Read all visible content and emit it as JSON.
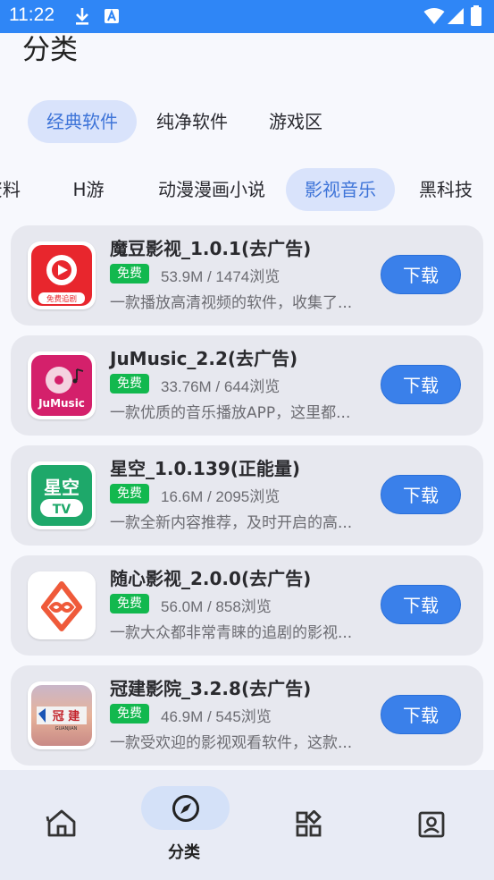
{
  "status_bar": {
    "time": "11:22"
  },
  "page": {
    "title": "分类"
  },
  "primary_tabs": [
    {
      "label": "经典软件",
      "active": true
    },
    {
      "label": "纯净软件",
      "active": false
    },
    {
      "label": "游戏区",
      "active": false
    }
  ],
  "secondary_tabs": [
    {
      "label": "资料",
      "active": false
    },
    {
      "label": "H游",
      "active": false
    },
    {
      "label": "动漫漫画小说",
      "active": false
    },
    {
      "label": "影视音乐",
      "active": true
    },
    {
      "label": "黑科技",
      "active": false
    }
  ],
  "apps": [
    {
      "name": "魔豆影视_1.0.1(去广告)",
      "badge": "免费",
      "stats": "53.9M / 1474浏览",
      "desc": "一款播放高清视频的软件，收集了...",
      "button": "下载",
      "icon_text": "免费追剧"
    },
    {
      "name": "JuMusic_2.2(去广告)",
      "badge": "免费",
      "stats": "33.76M / 644浏览",
      "desc": "一款优质的音乐播放APP，这里都...",
      "button": "下载",
      "icon_text": "JuMusic"
    },
    {
      "name": "星空_1.0.139(正能量)",
      "badge": "免费",
      "stats": "16.6M / 2095浏览",
      "desc": "一款全新内容推荐，及时开启的高...",
      "button": "下载",
      "icon_text": "星空",
      "icon_text2": "TV"
    },
    {
      "name": "随心影视_2.0.0(去广告)",
      "badge": "免费",
      "stats": "56.0M / 858浏览",
      "desc": "一款大众都非常青睐的追剧的影视...",
      "button": "下载"
    },
    {
      "name": "冠建影院_3.2.8(去广告)",
      "badge": "免费",
      "stats": "46.9M / 545浏览",
      "desc": "一款受欢迎的影视观看软件，这款...",
      "button": "下载",
      "icon_text": "冠 建",
      "icon_text2": "GUANJIAN"
    }
  ],
  "bottom_nav": [
    {
      "icon": "home-icon",
      "label": ""
    },
    {
      "icon": "compass-icon",
      "label": "分类",
      "active": true
    },
    {
      "icon": "apps-grid-icon",
      "label": ""
    },
    {
      "icon": "profile-icon",
      "label": ""
    }
  ],
  "colors": {
    "status_bar": "#2f86f6",
    "accent": "#3a80ea",
    "active_tab_bg": "#d9e3fb",
    "badge_green": "#12b84e"
  }
}
